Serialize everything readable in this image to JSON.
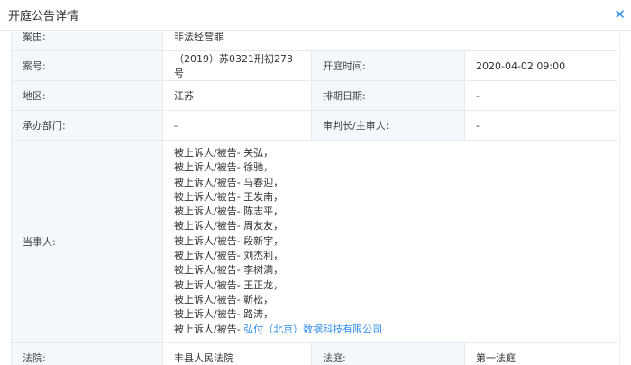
{
  "header": {
    "title": "开庭公告详情",
    "close_icon": "close-icon"
  },
  "rows": {
    "cause": {
      "label": "案由:",
      "value": "非法经营罪"
    },
    "case_no": {
      "label": "案号:",
      "value": "（2019）苏0321刑初273号"
    },
    "hearing_time": {
      "label": "开庭时间:",
      "value": "2020-04-02 09:00"
    },
    "region": {
      "label": "地区:",
      "value": "江苏"
    },
    "schedule_date": {
      "label": "排期日期:",
      "value": "-"
    },
    "department": {
      "label": "承办部门:",
      "value": "-"
    },
    "judge": {
      "label": "审判长/主审人:",
      "value": "-"
    },
    "parties": {
      "label": "当事人:",
      "role": "被上诉人/被告-",
      "names": [
        "关弘，",
        "徐驰，",
        "马春迎，",
        "王发南，",
        "陈志平，",
        "周友友，",
        "段新宇，",
        "刘杰利，",
        "李树满，",
        "王正龙，",
        "靳松，",
        "路涛，"
      ],
      "company": "弘付（北京）数据科技有限公司"
    },
    "court": {
      "label": "法院:",
      "value": "丰县人民法院"
    },
    "courtroom": {
      "label": "法庭:",
      "value": "第一法庭"
    }
  },
  "colors": {
    "accent": "#2d8cf0",
    "label_bg": "#f2f8fc"
  }
}
